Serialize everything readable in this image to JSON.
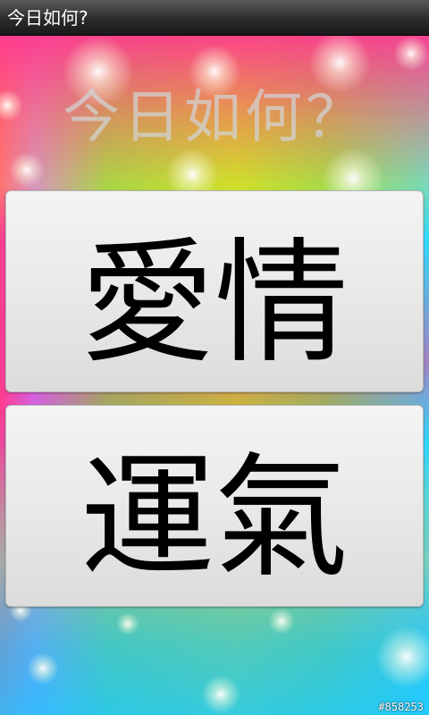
{
  "window": {
    "title": "今日如何?"
  },
  "main": {
    "headline": "今日如何？",
    "buttons": [
      {
        "label": "愛情"
      },
      {
        "label": "運氣"
      }
    ]
  },
  "watermark": "#858253",
  "colors": {
    "titlebar": "#2b2b2b",
    "button_face": "#e9e9e9",
    "headline_text": "#d2d2d2"
  }
}
